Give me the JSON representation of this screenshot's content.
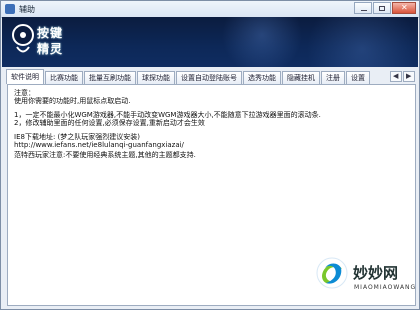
{
  "window": {
    "title": "辅助",
    "icon": "app-icon",
    "controls": {
      "minimize": "minimize-icon",
      "maximize": "maximize-icon",
      "close": "close-icon"
    }
  },
  "banner": {
    "logo_line1": "按键",
    "logo_line2": "精灵",
    "logo_icon": "keyboard-sprite-logo"
  },
  "tabs": [
    {
      "label": "软件说明",
      "active": true
    },
    {
      "label": "比赛功能",
      "active": false
    },
    {
      "label": "批量互刷功能",
      "active": false
    },
    {
      "label": "球探功能",
      "active": false
    },
    {
      "label": "设置自动登陆账号",
      "active": false
    },
    {
      "label": "选秀功能",
      "active": false
    },
    {
      "label": "隐藏挂机",
      "active": false
    },
    {
      "label": "注册",
      "active": false
    },
    {
      "label": "设置",
      "active": false
    }
  ],
  "tab_scroll": {
    "left": "chevron-left-icon",
    "right": "chevron-right-icon"
  },
  "content": {
    "lines": [
      "注意：",
      "使用你需要的功能时,用鼠标点取启动.",
      "1，一定不能最小化WGM游戏器,不能手动改变WGM游戏器大小,不能随意下拉游戏器里面的滚动条.",
      "2，修改辅助里面的任何设置,必须保存设置,重新启动才会生效",
      "IE8下载地址:  (梦之队玩家强烈建议安装)",
      "http://www.iefans.net/ie8lulanqi-guanfangxiazai/",
      "范特西玩家注意:不要使用经典系统主题,其他的主题都支持."
    ]
  },
  "watermark": {
    "main": "妙妙网",
    "sub": "MIAOMIAOWANG"
  }
}
